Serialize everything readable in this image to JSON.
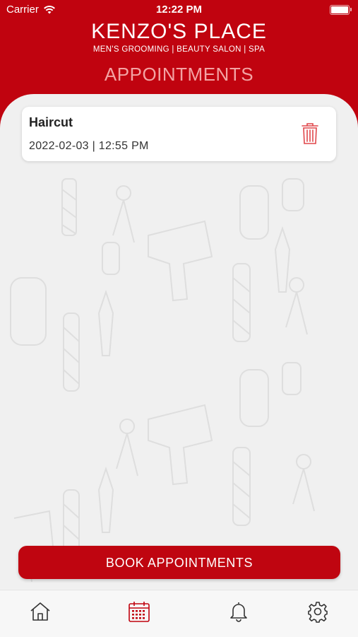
{
  "status_bar": {
    "carrier": "Carrier",
    "time": "12:22 PM"
  },
  "header": {
    "brand_name": "KENZO'S PLACE",
    "tagline": "MEN'S GROOMING | BEAUTY SALON | SPA",
    "page_title": "APPOINTMENTS"
  },
  "appointments": [
    {
      "service": "Haircut",
      "datetime": "2022-02-03  |  12:55 PM"
    }
  ],
  "book_button": {
    "label": "BOOK APPOINTMENTS"
  },
  "tabbar": {
    "items": [
      {
        "icon": "home-icon"
      },
      {
        "icon": "calendar-icon",
        "active": true
      },
      {
        "icon": "bell-icon"
      },
      {
        "icon": "gear-icon"
      }
    ]
  },
  "colors": {
    "brand_red": "#c0030f",
    "active_tab": "#c0030f",
    "page_title": "#f3a3a3"
  }
}
